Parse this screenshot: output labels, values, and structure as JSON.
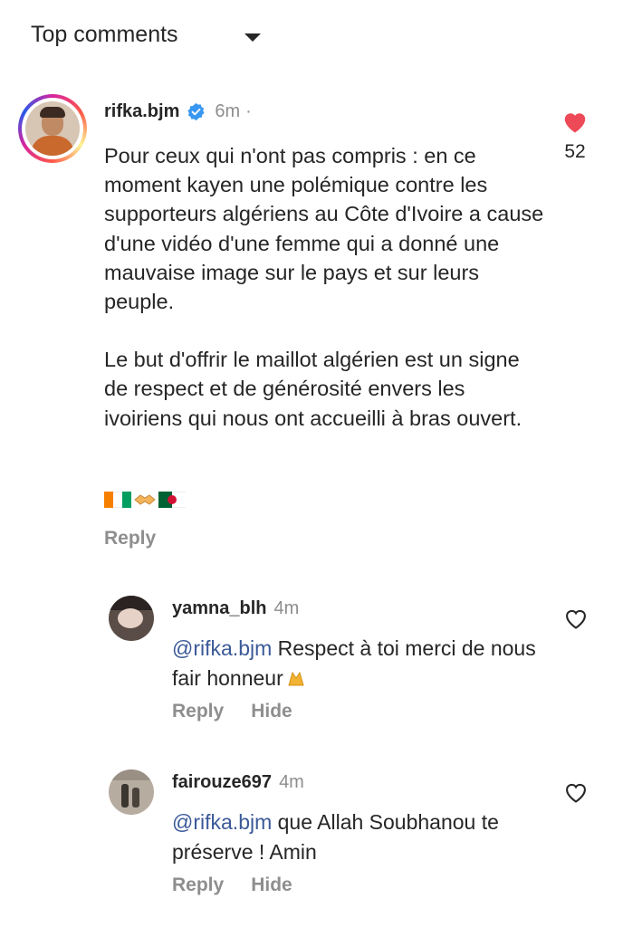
{
  "header": {
    "title": "Top comments",
    "sort_icon": "chevron-down-icon"
  },
  "comment": {
    "username": "rifka.bjm",
    "verified": true,
    "time": "6m",
    "separator": "·",
    "paragraph1": "Pour ceux qui n'ont pas compris : en ce moment kayen une polémique contre les supporteurs algériens au Côte d'Ivoire a cause d'une vidéo d'une femme qui a donné une mauvaise image sur le pays et sur leurs peuple.",
    "paragraph2": "Le but d'offrir le maillot algérien est un signe de respect et de générosité envers les ivoiriens qui nous ont accueilli à bras ouvert.",
    "emojis": [
      "flag-ivory-coast-icon",
      "handshake-icon",
      "flag-algeria-icon"
    ],
    "reply_label": "Reply",
    "likes": "52",
    "liked": true,
    "heart_color": "#ed4956"
  },
  "replies": [
    {
      "username": "yamna_blh",
      "time": "4m",
      "mention": "@rifka.bjm",
      "text": " Respect à toi merci de nous fair honneur",
      "trailing_emoji": "praying-hands-icon",
      "reply_label": "Reply",
      "hide_label": "Hide"
    },
    {
      "username": "fairouze697",
      "time": "4m",
      "mention": "@rifka.bjm",
      "text": " que Allah Soubhanou te préserve ! Amin",
      "reply_label": "Reply",
      "hide_label": "Hide"
    }
  ],
  "colors": {
    "text": "#262626",
    "secondary": "#8e8e8e",
    "mention": "#3b5998",
    "like": "#ed4956"
  }
}
